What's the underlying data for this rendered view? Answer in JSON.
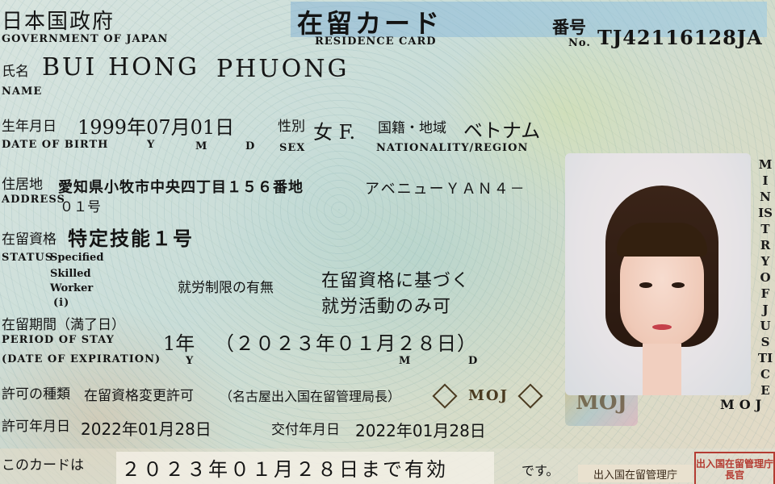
{
  "header": {
    "country_jp": "日本国政府",
    "country_en": "GOVERNMENT OF JAPAN",
    "card_title_jp": "在留カード",
    "card_title_en": "RESIDENCE CARD",
    "number_label_jp": "番号",
    "number_label_en": "No.",
    "number_value": "TJ42116128JA"
  },
  "name": {
    "label_jp": "氏名",
    "label_en": "NAME",
    "surname": "BUI",
    "middle": "HONG",
    "given": "PHUONG"
  },
  "birth": {
    "label_jp": "生年月日",
    "label_en": "DATE OF BIRTH",
    "value": "1999年07月01日",
    "y": "Y",
    "m": "M",
    "d": "D"
  },
  "sex": {
    "label_jp": "性別",
    "label_en": "SEX",
    "value": "女 F."
  },
  "nationality": {
    "label_jp": "国籍・地域",
    "label_en": "NATIONALITY/REGION",
    "value": "ベトナム"
  },
  "address": {
    "label_jp": "住居地",
    "label_en": "ADDRESS",
    "line1": "愛知県小牧市中央四丁目１５６番地",
    "line2": "アベニューＹＡＮ４－",
    "line3": "０１号"
  },
  "status": {
    "label_jp": "在留資格",
    "label_en": "STATUS",
    "value_jp": "特定技能１号",
    "value_en_1": "Specified",
    "value_en_2": "Skilled",
    "value_en_3": "Worker",
    "value_en_4": "(i)"
  },
  "work": {
    "label_jp": "就労制限の有無",
    "value_line1": "在留資格に基づく",
    "value_line2": "就労活動のみ可"
  },
  "period": {
    "label_jp": "在留期間（満了日）",
    "label_en_1": "PERIOD OF STAY",
    "label_en_2": "(DATE OF EXPIRATION)",
    "duration": "1年",
    "expiry": "（２０２３年０１月２８日）",
    "y": "Y",
    "m": "M",
    "d": "D"
  },
  "permit": {
    "type_label": "許可の種類",
    "type_value": "在留資格変更許可",
    "office": "（名古屋出入国在留管理局長）",
    "date_label": "許可年月日",
    "date_value": "2022年01月28日",
    "issue_label": "交付年月日",
    "issue_value": "2022年01月28日"
  },
  "validity": {
    "label": "このカードは",
    "value": "２０２３年０１月２８日まで有効",
    "suffix": "です。"
  },
  "security": {
    "moj": "MOJ",
    "vertical": "MINISTRY OF JUSTICE",
    "hologram": "MOJ",
    "mo_j": "MOJ",
    "seal_text": "出入国在留管理庁長官",
    "strip_text": "出入国在留管理庁"
  },
  "colors": {
    "ink": "#141414",
    "band": "#8ec3e2",
    "seal": "#b43c32"
  }
}
